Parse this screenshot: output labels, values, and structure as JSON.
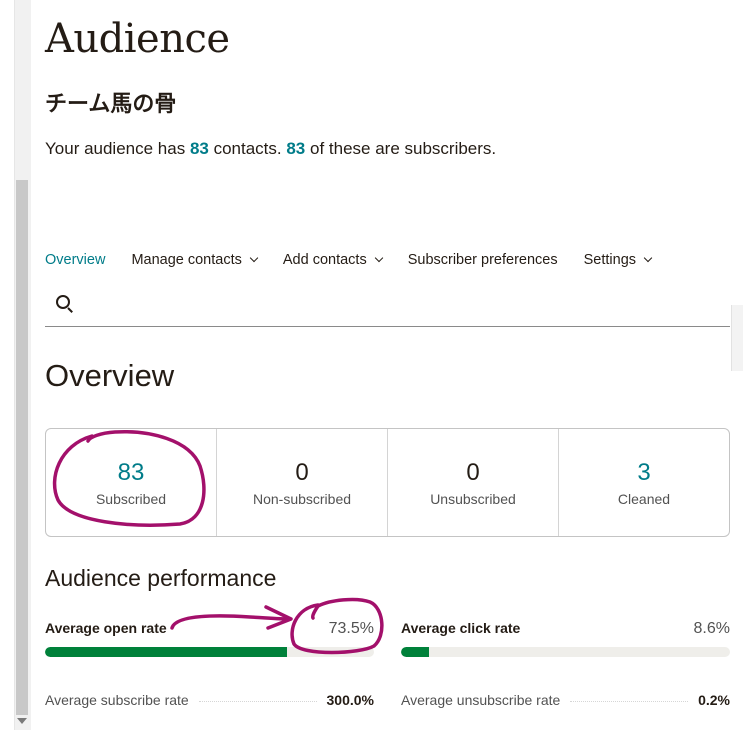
{
  "page": {
    "title": "Audience",
    "audience_name": "チーム馬の骨"
  },
  "summary": {
    "prefix": "Your audience has ",
    "contacts": "83",
    "middle": " contacts. ",
    "subscribers": "83",
    "suffix": " of these are subscribers."
  },
  "tabs": [
    {
      "label": "Overview",
      "active": true,
      "dropdown": false
    },
    {
      "label": "Manage contacts",
      "active": false,
      "dropdown": true,
      "icon": "chevron-down-icon"
    },
    {
      "label": "Add contacts",
      "active": false,
      "dropdown": true,
      "icon": "chevron-down-icon"
    },
    {
      "label": "Subscriber preferences",
      "active": false,
      "dropdown": false
    },
    {
      "label": "Settings",
      "active": false,
      "dropdown": true,
      "icon": "chevron-down-icon"
    }
  ],
  "search": {
    "icon": "search-icon",
    "placeholder": ""
  },
  "overview": {
    "heading": "Overview",
    "stats": [
      {
        "value": "83",
        "label": "Subscribed"
      },
      {
        "value": "0",
        "label": "Non-subscribed"
      },
      {
        "value": "0",
        "label": "Unsubscribed"
      },
      {
        "value": "3",
        "label": "Cleaned"
      }
    ]
  },
  "performance": {
    "heading": "Audience performance",
    "open_rate": {
      "label": "Average open rate",
      "value": "73.5%",
      "fill": 0.735
    },
    "click_rate": {
      "label": "Average click rate",
      "value": "8.6%",
      "fill": 0.086
    },
    "subscribe_rate": {
      "label": "Average subscribe rate",
      "value": "300.0%"
    },
    "unsubscribe_rate": {
      "label": "Average unsubscribe rate",
      "value": "0.2%"
    }
  },
  "colors": {
    "accent": "#007c89",
    "bar_fill": "#00813a",
    "annotation": "#a3106b"
  }
}
